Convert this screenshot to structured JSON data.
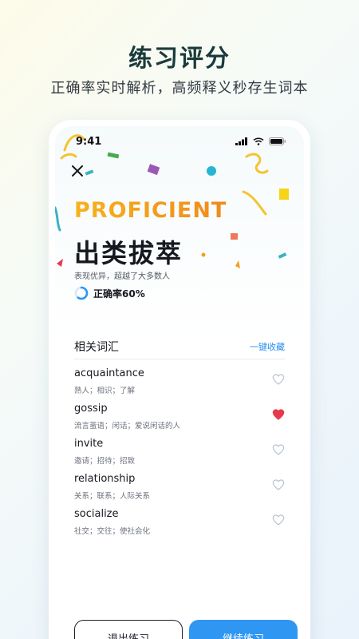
{
  "promo": {
    "title": "练习评分",
    "subtitle": "正确率实时解析，高频释义秒存生词本"
  },
  "status_bar": {
    "time": "9:41",
    "icons": [
      "signal-icon",
      "wifi-icon",
      "battery-icon"
    ]
  },
  "result": {
    "level_en": "PROFICIENT",
    "level_zh": "出类拔萃",
    "description": "表现优异，超越了大多数人",
    "accuracy_label": "正确率60%",
    "accuracy_value": 0.6
  },
  "related_words": {
    "title": "相关词汇",
    "collect_all": "一键收藏",
    "items": [
      {
        "word": "acquaintance",
        "meaning": "熟人；相识；了解",
        "favorited": false
      },
      {
        "word": "gossip",
        "meaning": "流言蜚语；闲话；爱说闲话的人",
        "favorited": true
      },
      {
        "word": "invite",
        "meaning": "邀请；招待；招致",
        "favorited": false
      },
      {
        "word": "relationship",
        "meaning": "关系；联系；人际关系",
        "favorited": false
      },
      {
        "word": "socialize",
        "meaning": "社交；交往；使社会化",
        "favorited": false
      }
    ]
  },
  "actions": {
    "exit_label": "退出练习",
    "continue_label": "继续练习"
  },
  "colors": {
    "accent": "#2f96f2",
    "heart_active": "#e8394a",
    "title_gold": "#f0a21a"
  }
}
